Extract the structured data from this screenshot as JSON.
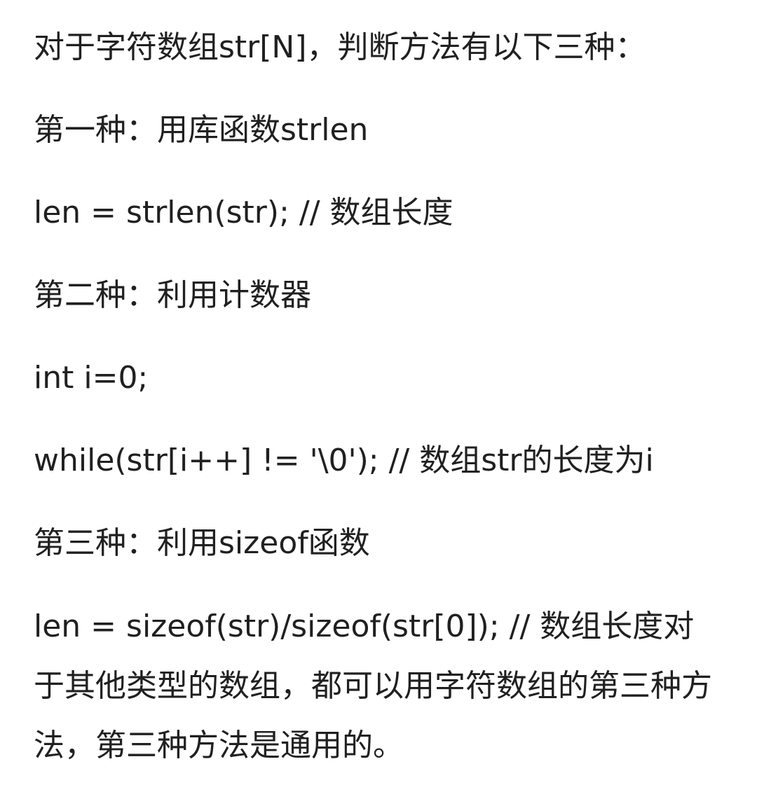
{
  "document": {
    "lines": [
      "对于字符数组str[N]，判断方法有以下三种：",
      "第一种：用库函数strlen",
      "len = strlen(str); // 数组长度",
      "第二种：利用计数器",
      "int i=0;",
      "while(str[i++] != '\\0'); // 数组str的长度为i",
      "第三种：利用sizeof函数",
      "len = sizeof(str)/sizeof(str[0]); // 数组长度对于其他类型的数组，都可以用字符数组的第三种方法，第三种方法是通用的。"
    ]
  }
}
